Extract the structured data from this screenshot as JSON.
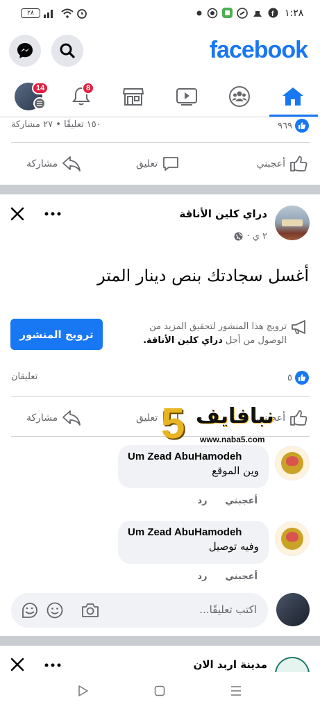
{
  "status_bar": {
    "time": "١:٢٨",
    "battery": "٢٨"
  },
  "header": {
    "logo": "facebook"
  },
  "nav": {
    "notifications_badge": "8",
    "profile_badge": "14"
  },
  "prev_post": {
    "reactions_count": "٩٦٩",
    "stats": "١٥٠ تعليقًا • ٢٧ مشاركة",
    "like_label": "أعجبني",
    "comment_label": "تعليق",
    "share_label": "مشاركة"
  },
  "post": {
    "author": "دراي كلين الأناقة",
    "time": "٢ ي ·",
    "text": "أغسل سجادتك بنص دينار المتر",
    "promo_text": "ترويج هذا المنشور لتحقيق المزيد من الوصول من أجل",
    "promo_page": "دراي كلين الأناقة.",
    "boost_button": "ترويج المنشور",
    "reactions_count": "٥",
    "comments_count": "تعليقان",
    "like_label": "أعجبني",
    "comment_label": "تعليق",
    "share_label": "مشاركة"
  },
  "comments": [
    {
      "name": "Um Zead AbuHamodeh",
      "text": "وين الموقع",
      "like": "أعجبني",
      "reply": "رد"
    },
    {
      "name": "Um Zead AbuHamodeh",
      "text": "وفيه توصيل",
      "like": "أعجبني",
      "reply": "رد"
    }
  ],
  "comment_input": {
    "placeholder": "اكتب تعليقًا..."
  },
  "watermark": {
    "brand": "نبافايف",
    "number": "5",
    "url": "www.naba5.com"
  },
  "next_post": {
    "author": "مدينة اربد الان"
  },
  "colors": {
    "brand": "#1877f2",
    "badge": "#e41e3f"
  }
}
